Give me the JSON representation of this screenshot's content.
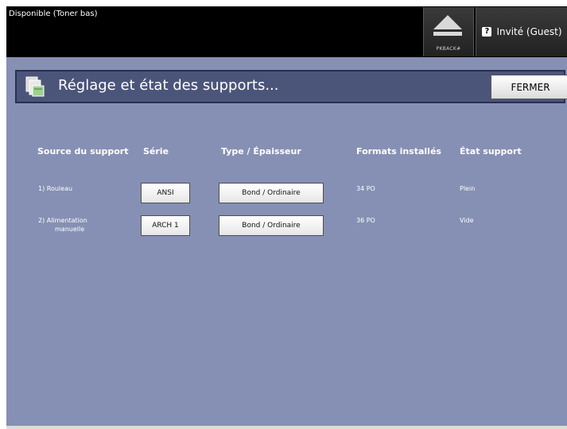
{
  "status": {
    "text": "Disponible (Toner bas)"
  },
  "top_buttons": {
    "eject_label": "PKBACK#",
    "user_label": "Invité (Guest)",
    "user_icon_char": "?"
  },
  "title_panel": {
    "title": "Réglage et état des supports...",
    "close_label": "FERMER"
  },
  "table": {
    "headers": {
      "source": "Source du support",
      "series": "Série",
      "type": "Type / Épaisseur",
      "formats": "Formats installés",
      "state": "État support"
    },
    "rows": [
      {
        "source_line1": "1) Rouleau",
        "source_line2": "",
        "series": "ANSI",
        "type": "Bond / Ordinaire",
        "format": "34 PO",
        "state": "Plein"
      },
      {
        "source_line1": "2) Alimentation",
        "source_line2": "manuelle",
        "series": "ARCH 1",
        "type": "Bond / Ordinaire",
        "format": "36 PO",
        "state": "Vide"
      }
    ]
  },
  "colors": {
    "background": "#8690b4",
    "top_bar": "#000000",
    "title_panel": "#4b557a",
    "button": "#f2f2f2"
  },
  "icons": [
    "eject-icon",
    "user-icon",
    "media-tray-icon"
  ]
}
